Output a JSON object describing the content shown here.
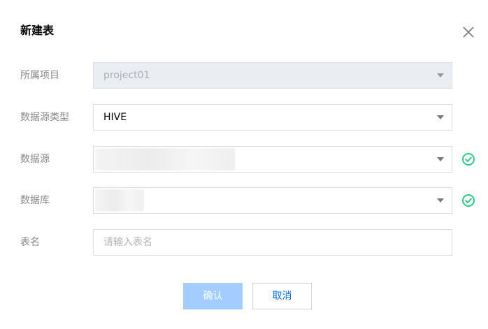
{
  "dialog": {
    "title": "新建表",
    "close_icon": "close-icon"
  },
  "form": {
    "project": {
      "label": "所属项目",
      "value": "project01",
      "disabled": true
    },
    "datasource_type": {
      "label": "数据源类型",
      "value": "HIVE"
    },
    "datasource": {
      "label": "数据源",
      "value": "",
      "status": "valid"
    },
    "database": {
      "label": "数据库",
      "value": "",
      "status": "valid"
    },
    "table_name": {
      "label": "表名",
      "placeholder": "请输入表名",
      "value": ""
    }
  },
  "buttons": {
    "confirm_label": "确认",
    "cancel_label": "取消"
  },
  "colors": {
    "primary": "#006eff",
    "primary_disabled": "#a3ccff",
    "success": "#29cc85"
  }
}
